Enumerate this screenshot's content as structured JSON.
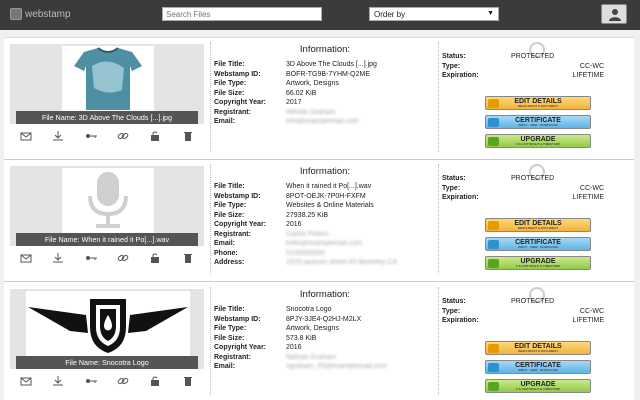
{
  "header": {
    "logo_text": "webstamp",
    "search_placeholder": "Search Files",
    "order_by": "Order by"
  },
  "labels": {
    "info_heading": "Information:",
    "file_title": "File Title:",
    "webstamp_id": "Webstamp ID:",
    "file_type": "File Type:",
    "file_size": "File Size:",
    "copyright_year": "Copyright Year:",
    "registrant": "Registrant:",
    "email": "Email:",
    "phone": "Phone:",
    "address": "Address:",
    "status": "Status:",
    "type": "Type:",
    "expiration": "Expiration:"
  },
  "buttons": {
    "edit": "EDIT DETAILS",
    "edit_sub": "REGISTRANT & DOCUMENT",
    "cert": "CERTIFICATE",
    "cert_sub": "PRINT · VIEW · DOWNLOAD",
    "upgrade": "UPGRADE",
    "upgrade_sub": "U.S COPYRIGHT & TIMESTAMP"
  },
  "cards": [
    {
      "file_name": "File Name: 3D Above The Clouds [...].jpg",
      "title": "3D Above The Clouds [...].jpg",
      "webstamp_id": "BOFR-TG9B-7YHM-Q2ME",
      "file_type": "Artwork, Designs",
      "file_size": "66.02 KiB",
      "copyright_year": "2017",
      "registrant": "Alfredo Graham",
      "email": "info@examplemail.com",
      "status": "PROTECTED",
      "type": "CC-WC",
      "expiration": "LIFETIME"
    },
    {
      "file_name": "File Name: When it rained it Po[...].wav",
      "title": "When it rained it Po[...].wav",
      "webstamp_id": "8POT-OEJK-7P0H-FXFM",
      "file_type": "Websites & Online Materials",
      "file_size": "27938.25 KiB",
      "copyright_year": "2016",
      "registrant": "Carlos Peters",
      "email": "hello@examplemail.com",
      "phone": "5105550000",
      "address": "1525 jackson street #3 Berkeley CA",
      "status": "PROTECTED",
      "type": "CC-WC",
      "expiration": "LIFETIME"
    },
    {
      "file_name": "File Name: Snocotra Logo",
      "title": "Snocotra Logo",
      "webstamp_id": "8PJY-3JE4-Q2HJ-M2LX",
      "file_type": "Artwork, Designs",
      "file_size": "573.8 KiB",
      "copyright_year": "2016",
      "registrant": "Nathan Graham",
      "email": "ngraham_55@examplemail.com",
      "status": "PROTECTED",
      "type": "CC-WC",
      "expiration": "LIFETIME"
    }
  ],
  "colors": {
    "topbar": "#3b3b3b",
    "edit_button": "#f3b33d",
    "certificate_button": "#5cb5e8",
    "upgrade_button": "#93c94a"
  }
}
